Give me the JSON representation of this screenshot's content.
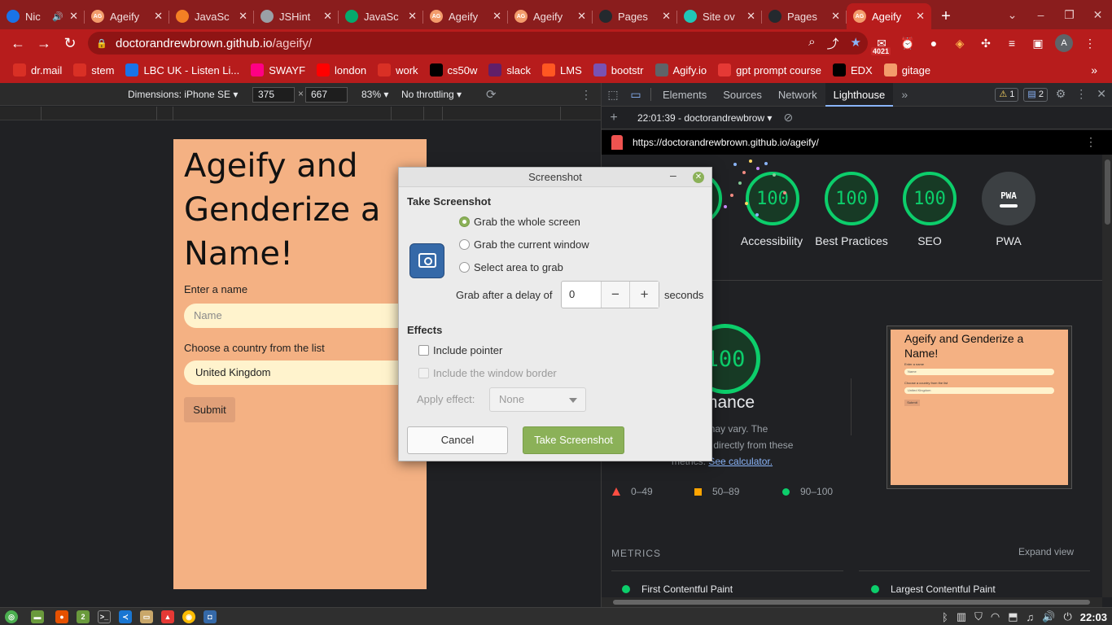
{
  "browser": {
    "tabs": [
      {
        "label": "Nic",
        "favicon": "bing",
        "color": "#1a73e8",
        "audio": true
      },
      {
        "label": "Ageify",
        "favicon": "AG",
        "color": "#f39c6b"
      },
      {
        "label": "JavaSc",
        "favicon": "stackoverflow",
        "color": "#f48024"
      },
      {
        "label": "JSHint",
        "favicon": "globe",
        "color": "#9aa0a6"
      },
      {
        "label": "JavaSc",
        "favicon": "w3schools",
        "color": "#04aa6d"
      },
      {
        "label": "Ageify",
        "favicon": "AG",
        "color": "#f39c6b"
      },
      {
        "label": "Ageify",
        "favicon": "AG",
        "color": "#f39c6b"
      },
      {
        "label": "Pages",
        "favicon": "github",
        "color": "#24292e"
      },
      {
        "label": "Site ov",
        "favicon": "netlify",
        "color": "#20c6b7"
      },
      {
        "label": "Pages",
        "favicon": "github",
        "color": "#24292e"
      },
      {
        "label": "Ageify",
        "favicon": "AG",
        "color": "#f39c6b",
        "active": true
      }
    ],
    "url_host": "doctorandrewbrown.github.io",
    "url_path": "/ageify/",
    "extension_badge": "4021",
    "avatar_letter": "A",
    "bookmarks": [
      {
        "label": "dr.mail",
        "icon": "gmail-icon",
        "color": "#d93025"
      },
      {
        "label": "stem",
        "icon": "gmail-icon",
        "color": "#d93025"
      },
      {
        "label": "LBC UK - Listen Li...",
        "icon": "lbc-icon",
        "color": "#1a73e8"
      },
      {
        "label": "SWAYF",
        "icon": "flickr-icon",
        "color": "#ff0084"
      },
      {
        "label": "london",
        "icon": "youtube-icon",
        "color": "#ff0000"
      },
      {
        "label": "work",
        "icon": "gmail-icon",
        "color": "#d93025"
      },
      {
        "label": "cs50w",
        "icon": "x-icon",
        "color": "#000000"
      },
      {
        "label": "slack",
        "icon": "slack-icon",
        "color": "#611f69"
      },
      {
        "label": "LMS",
        "icon": "lms-icon",
        "color": "#ff5722"
      },
      {
        "label": "bootstr",
        "icon": "bootstrap-icon",
        "color": "#7952b3"
      },
      {
        "label": "Agify.io",
        "icon": "globe-icon",
        "color": "#5f6368"
      },
      {
        "label": "gpt prompt course",
        "icon": "course-icon",
        "color": "#e53935"
      },
      {
        "label": "EDX",
        "icon": "x-icon",
        "color": "#000000"
      },
      {
        "label": "gitage",
        "icon": "ageify-icon",
        "color": "#f39c6b"
      }
    ]
  },
  "device_toolbar": {
    "dimensions_label": "Dimensions: iPhone SE",
    "width": "375",
    "height": "667",
    "zoom": "83%",
    "throttling": "No throttling"
  },
  "page": {
    "heading": "Ageify and Genderize a Name!",
    "name_label": "Enter a name",
    "name_placeholder": "Name",
    "country_label": "Choose a country from the list",
    "country_value": "United Kingdom",
    "submit_label": "Submit"
  },
  "devtools": {
    "tabs": [
      "Elements",
      "Sources",
      "Network",
      "Lighthouse"
    ],
    "active_tab": "Lighthouse",
    "warnings": "1",
    "messages": "2",
    "report_label": "22:01:39 - doctorandrewbrow",
    "report_url": "https://doctorandrewbrown.github.io/ageify/",
    "scores": [
      {
        "label": "Accessibility",
        "value": "100"
      },
      {
        "label": "Best Practices",
        "value": "100"
      },
      {
        "label": "SEO",
        "value": "100"
      },
      {
        "label": "PWA",
        "value": "PWA"
      }
    ],
    "partial_label_left": "ce",
    "performance": {
      "score": "100",
      "title_partial": "rmance",
      "desc_1": "ted and may vary. The",
      "desc_2": "alculated",
      "desc_3": " directly from these",
      "desc_4": "metrics. ",
      "calc_link": "See calculator."
    },
    "legend": [
      "0–49",
      "50–89",
      "90–100"
    ],
    "thumbnail": {
      "heading": "Ageify and Genderize a Name!",
      "name_label": "Enter a name",
      "name_placeholder": "Name",
      "country_label": "Choose a country from the list",
      "country_value": "United Kingdom",
      "submit_label": "Submit"
    },
    "metrics_heading": "METRICS",
    "expand_label": "Expand view",
    "metrics": [
      "First Contentful Paint",
      "Largest Contentful Paint"
    ]
  },
  "dialog": {
    "title": "Screenshot",
    "section_take": "Take Screenshot",
    "option_whole": "Grab the whole screen",
    "option_window": "Grab the current window",
    "option_area": "Select area to grab",
    "delay_label": "Grab after a delay of",
    "delay_value": "0",
    "seconds_label": "seconds",
    "section_effects": "Effects",
    "include_pointer": "Include pointer",
    "include_border": "Include the window border",
    "apply_effect_label": "Apply effect:",
    "effect_value": "None",
    "cancel_label": "Cancel",
    "take_label": "Take Screenshot"
  },
  "taskbar": {
    "workspace_badge": "2",
    "clock": "22:03"
  }
}
